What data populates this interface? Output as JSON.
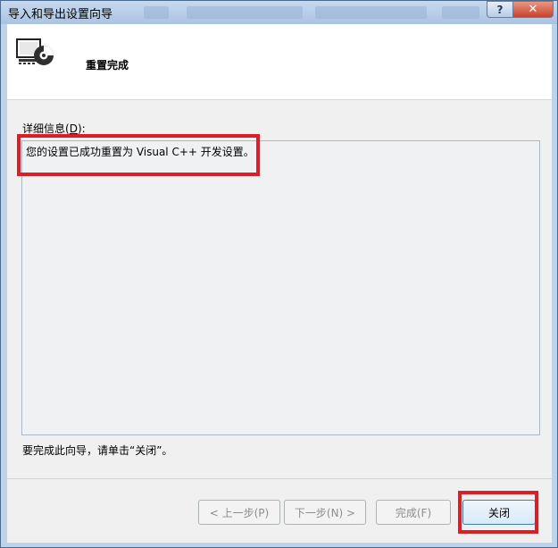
{
  "window": {
    "title": "导入和导出设置向导",
    "help_label": "?",
    "close_label": "✕"
  },
  "header": {
    "title": "重置完成",
    "icon": "settings-wizard-icon"
  },
  "details": {
    "label_prefix": "详细信息(",
    "label_key": "D",
    "label_suffix": "):",
    "text": "您的设置已成功重置为 Visual C++ 开发设置。"
  },
  "footer": {
    "instruction": "要完成此向导，请单击“关闭”。"
  },
  "buttons": {
    "prev": "< 上一步(P)",
    "next": "下一步(N) >",
    "finish": "完成(F)",
    "close": "关闭"
  },
  "colors": {
    "highlight": "#dc1f26",
    "titlebar": "#bcd3ea"
  }
}
